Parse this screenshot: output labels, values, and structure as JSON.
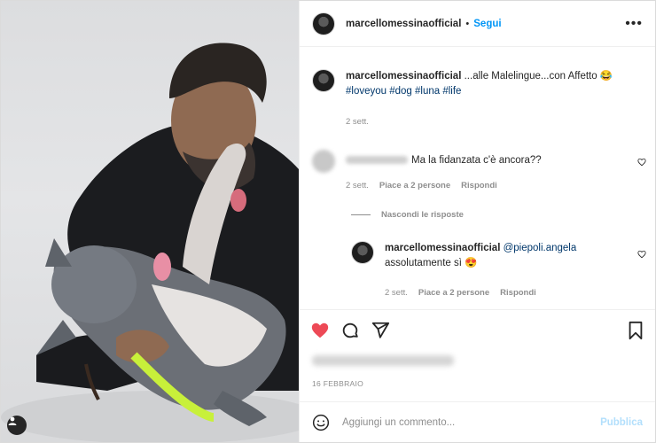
{
  "post": {
    "username": "marcellomessinaofficial",
    "separator": "•",
    "follow_label": "Segui",
    "more_label": "•••"
  },
  "caption": {
    "username": "marcellomessinaofficial",
    "text": "...alle Malelingue...con Affetto 😂",
    "hashtags": "#loveyou #dog #luna #life",
    "time": "2 sett."
  },
  "comment1": {
    "text": "Ma la fidanzata c'è ancora??",
    "time": "2 sett.",
    "likes": "Piace a 2 persone",
    "reply_label": "Rispondi"
  },
  "hide_replies_label": "Nascondi le risposte",
  "reply1": {
    "username": "marcellomessinaofficial",
    "mention": "@piepoli.angela",
    "text": "assolutamente sì 😍",
    "time": "2 sett.",
    "likes": "Piace a 2 persone",
    "reply_label": "Rispondi"
  },
  "date": "16 FEBBRAIO",
  "add_comment": {
    "placeholder": "Aggiungi un commento...",
    "publish_label": "Pubblica"
  },
  "colors": {
    "accent": "#0095f6",
    "like": "#ed4956",
    "text": "#262626",
    "muted": "#8e8e8e",
    "publish_disabled": "#b2dffc"
  },
  "icons": [
    "heart-icon",
    "comment-icon",
    "share-icon",
    "bookmark-icon",
    "emoji-icon",
    "user-tag-icon",
    "like-comment-icon"
  ]
}
